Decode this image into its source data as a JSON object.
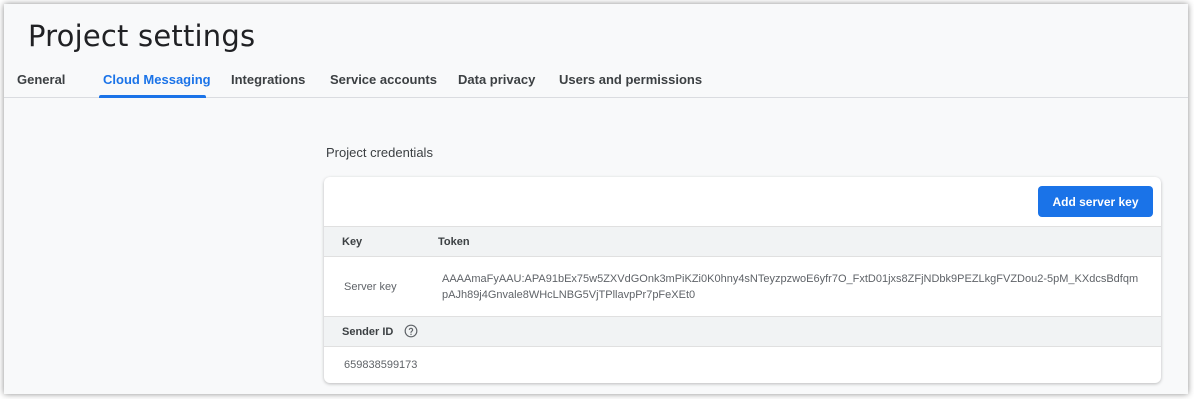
{
  "page": {
    "title": "Project settings"
  },
  "tabs": [
    {
      "label": "General",
      "active": false
    },
    {
      "label": "Cloud Messaging",
      "active": true
    },
    {
      "label": "Integrations",
      "active": false
    },
    {
      "label": "Service accounts",
      "active": false
    },
    {
      "label": "Data privacy",
      "active": false
    },
    {
      "label": "Users and permissions",
      "active": false
    }
  ],
  "credentials": {
    "section_label": "Project credentials",
    "add_button_label": "Add server key",
    "columns": {
      "key": "Key",
      "token": "Token"
    },
    "server_key": {
      "label": "Server key",
      "token": "AAAAmaFyAAU:APA91bEx75w5ZXVdGOnk3mPiKZi0K0hny4sNTeyzpzwoE6yfr7O_FxtD01jxs8ZFjNDbk9PEZLkgFVZDou2-5pM_KXdcsBdfqmpAJh89j4Gnvale8WHcLNBG5VjTPllavpPr7pFeXEt0"
    },
    "sender": {
      "label": "Sender ID",
      "help_icon": "help-circle-icon",
      "value": "659838599173"
    }
  },
  "colors": {
    "accent": "#1a73e8",
    "text": "#3c4043",
    "muted": "#5f6368",
    "background": "#f8f9fa",
    "header_bg": "#f1f3f4"
  }
}
